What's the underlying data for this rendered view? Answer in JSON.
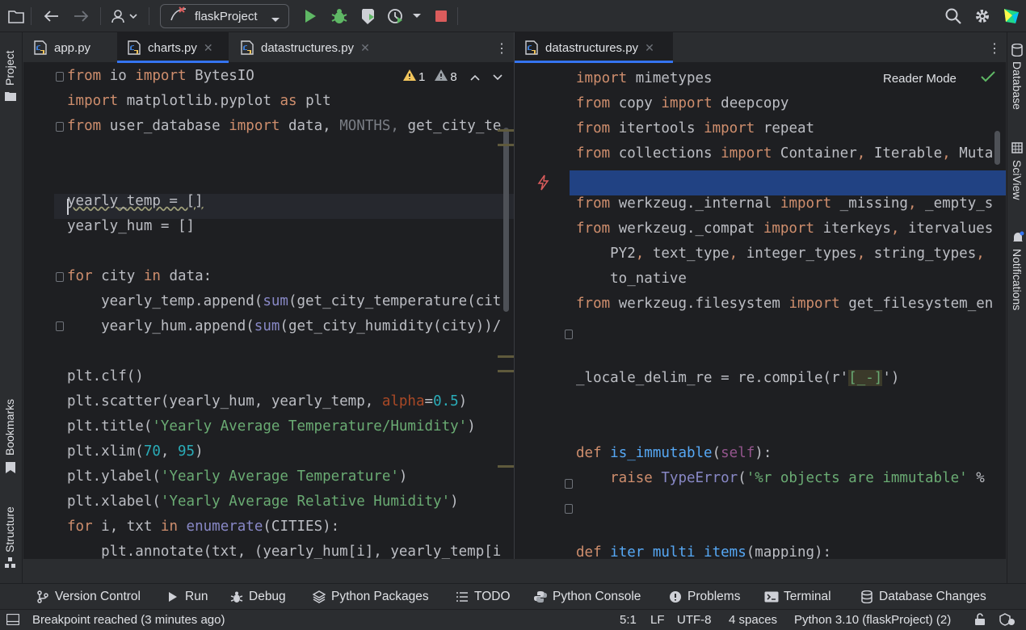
{
  "toolbar": {
    "project_name": "flaskProject"
  },
  "colors": {
    "accent": "#3574f0",
    "run_green": "#5fb865",
    "stop_red": "#db5c5c",
    "warning": "#f2c55c"
  },
  "left_strip": {
    "project": "Project",
    "bookmarks": "Bookmarks",
    "structure": "Structure"
  },
  "right_strip": {
    "database": "Database",
    "sciview": "SciView",
    "notifications": "Notifications"
  },
  "left_editor": {
    "tabs": [
      {
        "label": "app.py"
      },
      {
        "label": "charts.py"
      },
      {
        "label": "datastructures.py"
      }
    ],
    "inspections": {
      "warnings": "1",
      "weak_warnings": "8"
    }
  },
  "right_editor": {
    "tabs": [
      {
        "label": "datastructures.py"
      }
    ],
    "reader_mode": "Reader Mode"
  },
  "tool_windows": [
    {
      "label": "Version Control",
      "icon": "branch-icon"
    },
    {
      "label": "Run",
      "icon": "run-icon"
    },
    {
      "label": "Debug",
      "icon": "bug-icon"
    },
    {
      "label": "Python Packages",
      "icon": "layers-icon"
    },
    {
      "label": "TODO",
      "icon": "list-icon"
    },
    {
      "label": "Python Console",
      "icon": "python-icon"
    },
    {
      "label": "Problems",
      "icon": "info-icon"
    },
    {
      "label": "Terminal",
      "icon": "terminal-icon"
    },
    {
      "label": "Database Changes",
      "icon": "db-icon"
    }
  ],
  "status": {
    "message": "Breakpoint reached (3 minutes ago)",
    "position": "5:1",
    "line_sep": "LF",
    "encoding": "UTF-8",
    "indent": "4 spaces",
    "interpreter": "Python 3.10 (flaskProject) (2)"
  },
  "code": {
    "left": {
      "l1": [
        "from",
        "io",
        "import",
        "BytesIO"
      ],
      "l2": [
        "import",
        "matplotlib.pyplot",
        "as",
        "plt"
      ],
      "l3": [
        "from",
        "user_database",
        "import",
        "data,",
        "MONTHS,",
        "get_city_te"
      ],
      "l6": "yearly_temp = []",
      "l7": "yearly_hum = []",
      "l9": [
        "for",
        "city",
        "in",
        "data:"
      ],
      "l10": [
        "    yearly_temp.append(",
        "sum",
        "(get_city_temperature(cit"
      ],
      "l11": [
        "    yearly_hum.append(",
        "sum",
        "(get_city_humidity(city))/"
      ],
      "l13": "plt.clf()",
      "l14": [
        "plt.scatter(yearly_hum, yearly_temp, ",
        "alpha",
        "=",
        "0.5",
        ")"
      ],
      "l15": [
        "plt.title(",
        "'Yearly Average Temperature/Humidity'",
        ")"
      ],
      "l16": [
        "plt.xlim(",
        "70",
        ", ",
        "95",
        ")"
      ],
      "l17": [
        "plt.ylabel(",
        "'Yearly Average Temperature'",
        ")"
      ],
      "l18": [
        "plt.xlabel(",
        "'Yearly Average Relative Humidity'",
        ")"
      ],
      "l19": [
        "for",
        "i, txt",
        "in",
        "enumerate",
        "(CITIES):"
      ],
      "l20": "    plt.annotate(txt, (yearly_hum[i], yearly_temp[i"
    },
    "right": {
      "r1": [
        "import",
        "mimetypes"
      ],
      "r2": [
        "from",
        "copy",
        "import",
        "deepcopy"
      ],
      "r3": [
        "from",
        "itertools",
        "import",
        "repeat"
      ],
      "r4": [
        "from",
        "collections",
        "import",
        "Container",
        ", ",
        "Iterable",
        ", ",
        "Muta"
      ],
      "r6": [
        "from",
        "werkzeug._internal",
        "import",
        "_missing",
        ", ",
        "_empty_s"
      ],
      "r7": [
        "from",
        "werkzeug._compat",
        "import",
        "iterkeys",
        ", ",
        "itervalues"
      ],
      "r8": [
        "    PY2",
        ", ",
        "text_type",
        ", ",
        "integer_types",
        ", ",
        "string_types",
        ","
      ],
      "r9": "    to_native",
      "r10": [
        "from",
        "werkzeug.filesystem",
        "import",
        "get_filesystem_en"
      ],
      "r13": [
        "_locale_delim_re = re.compile(r'",
        "[_-]",
        "')"
      ],
      "r16": [
        "def",
        "is_immutable",
        "(",
        "self",
        "):"
      ],
      "r17": [
        "    raise",
        "TypeError",
        "(",
        "'%r objects are immutable'",
        " %"
      ],
      "r20": [
        "def",
        "iter_multi_items",
        "(mapping):"
      ]
    }
  }
}
